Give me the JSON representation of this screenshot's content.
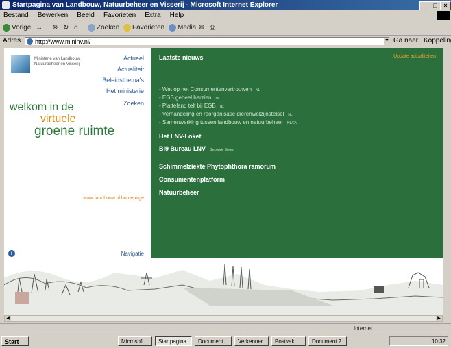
{
  "window": {
    "title": "Startpagina van Landbouw, Natuurbeheer en Visserij - Microsoft Internet Explorer",
    "min": "_",
    "max": "□",
    "close": "×"
  },
  "menubar": [
    "Bestand",
    "Bewerken",
    "Beeld",
    "Favorieten",
    "Extra",
    "Help"
  ],
  "toolbar": {
    "back": "Vorige",
    "forward": "→",
    "stop": "⊗",
    "refresh": "↻",
    "home": "⌂",
    "search": "Zoeken",
    "favorites": "Favorieten",
    "history": "Media",
    "mail": "✉",
    "print": "⎙"
  },
  "address": {
    "label": "Adres",
    "value": "http://www.minlnv.nl/",
    "go": "Ga naar",
    "links": "Koppelingen"
  },
  "left": {
    "logo_text": "Ministerie van Landbouw, Natuurbeheer en Visserij",
    "nav": [
      "Actueel",
      "Actualiteit",
      "Beleidsthema's",
      "Het ministerie",
      "Zoeken"
    ],
    "welcome_1": "welkom in de",
    "welcome_2": "virtuele",
    "welcome_3": "groene ruimte",
    "homepage_link": "www.landbouw.nl homepage",
    "bottom_nav": "Navigatie"
  },
  "right": {
    "title": "Laatste nieuws",
    "updated": "Update actualiteiten",
    "items": [
      {
        "text": "Wet op het Consumentenvertrouwen",
        "tag": "NL"
      },
      {
        "text": "EGB geheel herzien",
        "tag": "NL"
      },
      {
        "text": "Platteland telt bij EGB",
        "tag": "NL"
      },
      {
        "text": "Verhandeling en reorganisatie dierenwelzijnstelsel",
        "tag": "NL"
      },
      {
        "text": "Samenwerking tussen landbouw en natuurbeheer",
        "tag": "NL/EN"
      }
    ],
    "bold_links": [
      {
        "text": "Het LNV-Loket",
        "tag": ""
      },
      {
        "text": "Bi9 Bureau LNV",
        "tag": "Gezonde dieren"
      },
      {
        "text": "Schimmelziekte Phytophthora ramorum",
        "tag": ""
      },
      {
        "text": "Consumentenplatform",
        "tag": ""
      },
      {
        "text": "Natuurbeheer",
        "tag": ""
      }
    ]
  },
  "status": {
    "text": "Internet"
  },
  "taskbar": {
    "start": "Start",
    "tasks": [
      "Microsoft",
      "Startpagina...",
      "Document...",
      "Verkenner",
      "Postvak",
      "Document 2"
    ],
    "clock": "10:32"
  },
  "colors": {
    "panel_green": "#2b6f3c",
    "welcome_green": "#2f7a3d",
    "welcome_orange": "#d48a1c",
    "link_blue": "#2c5c99"
  }
}
